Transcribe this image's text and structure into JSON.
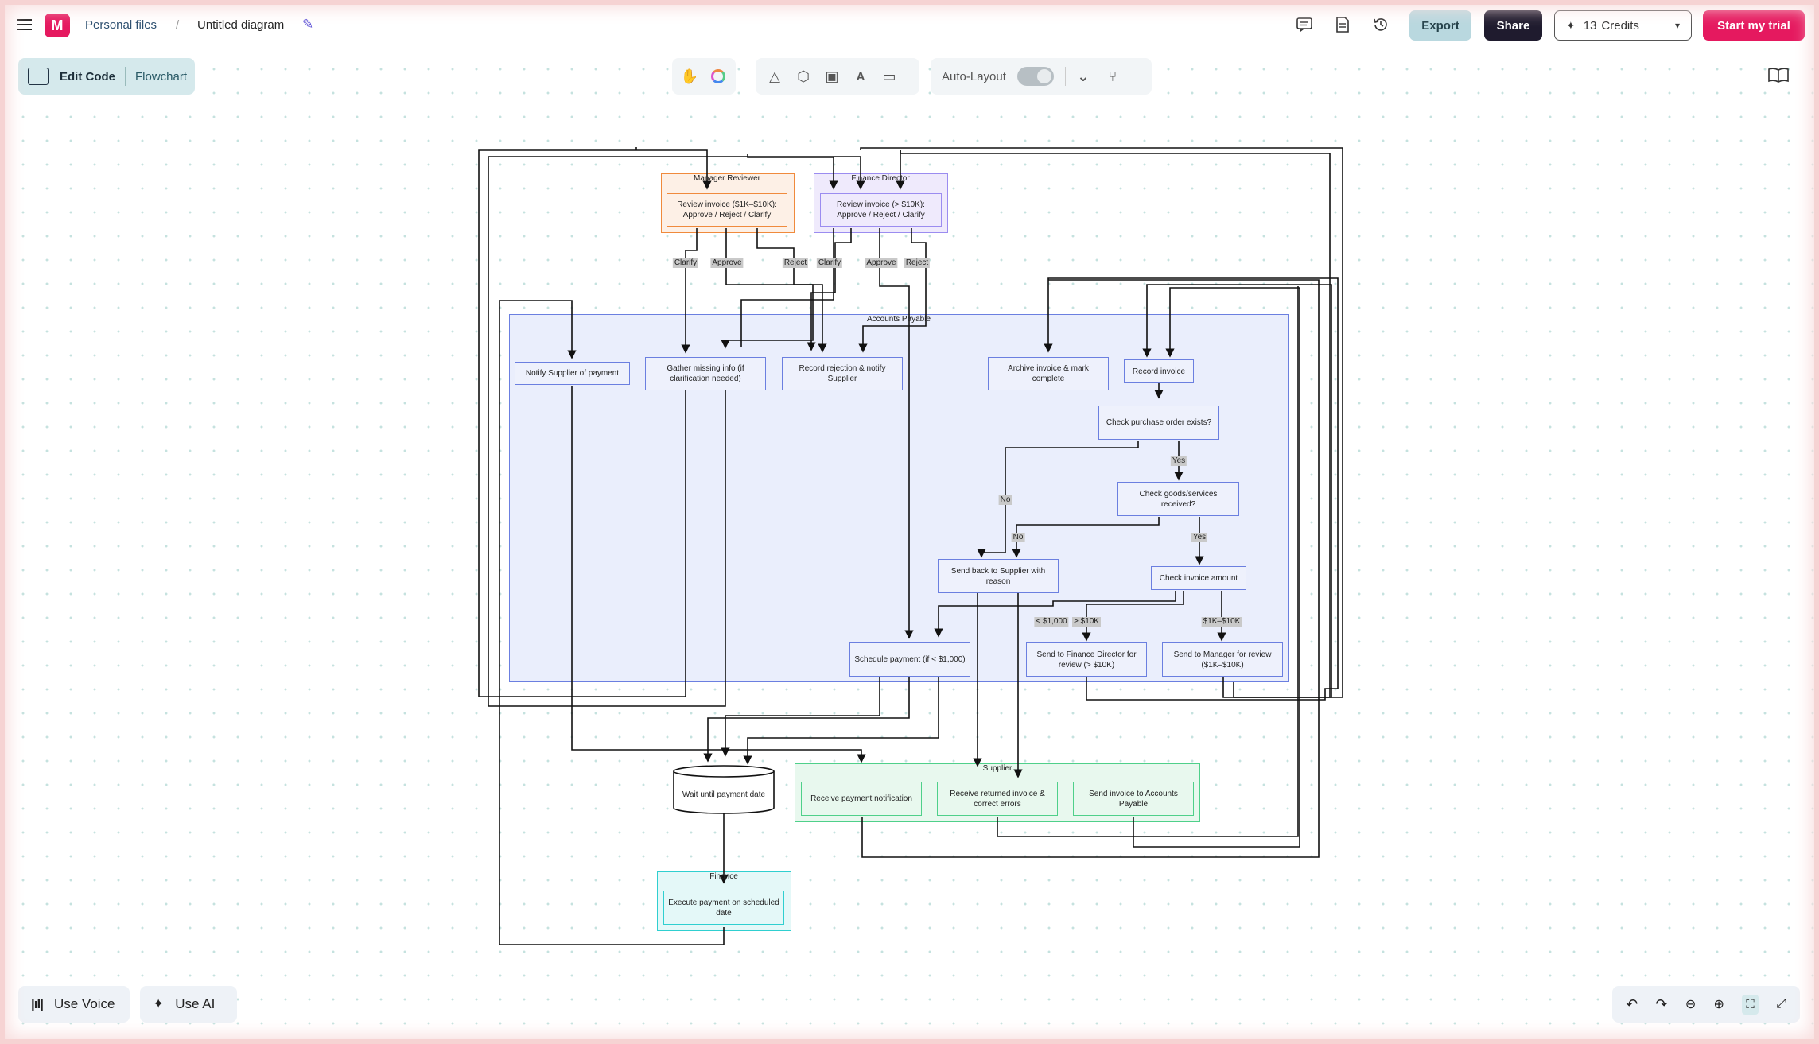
{
  "header": {
    "breadcrumb_root": "Personal files",
    "separator": "/",
    "title": "Untitled diagram",
    "export_label": "Export",
    "share_label": "Share",
    "credits_count": "13",
    "credits_label": "Credits",
    "trial_label": "Start my trial"
  },
  "mode": {
    "edit_code_label": "Edit Code",
    "diagram_type": "Flowchart"
  },
  "toolbar": {
    "auto_layout_label": "Auto-Layout",
    "auto_layout_on": false
  },
  "bottom": {
    "voice_label": "Use Voice",
    "ai_label": "Use AI"
  },
  "colors": {
    "brand": "#e5195f",
    "export_bg": "#b9d8df",
    "share_bg": "#1f1b2e",
    "ap_border": "#6b7fe0",
    "ap_fill": "#eaeefc",
    "manager_border": "#f08a3c",
    "finance_dir_border": "#9b8cf0",
    "supplier_border": "#4fd08a",
    "finance_border": "#2fcfd0"
  },
  "diagram": {
    "groups": {
      "manager": "Manager Reviewer",
      "finance_director": "Finance Director",
      "accounts_payable": "Accounts Payable",
      "supplier": "Supplier",
      "finance": "Finance"
    },
    "nodes": {
      "manager_review": "Review invoice ($1K–$10K): Approve / Reject / Clarify",
      "director_review": "Review invoice (> $10K): Approve / Reject / Clarify",
      "notify_supplier": "Notify Supplier of payment",
      "gather_info": "Gather missing info (if clarification needed)",
      "record_rejection": "Record rejection & notify Supplier",
      "archive": "Archive invoice & mark complete",
      "record_invoice": "Record invoice",
      "check_po": "Check purchase order exists?",
      "check_goods": "Check goods/services received?",
      "send_back": "Send back to Supplier with reason",
      "check_amount": "Check invoice amount",
      "schedule_payment": "Schedule payment (if < $1,000)",
      "send_director": "Send to Finance Director for review (> $10K)",
      "send_manager": "Send to Manager for review ($1K–$10K)",
      "wait_payment": "Wait until payment date",
      "receive_payment": "Receive payment notification",
      "receive_returned": "Receive returned invoice & correct errors",
      "send_invoice": "Send invoice to Accounts Payable",
      "execute_payment": "Execute payment on scheduled date"
    },
    "edge_labels": {
      "m_clarify": "Clarify",
      "m_approve": "Approve",
      "m_reject": "Reject",
      "d_clarify": "Clarify",
      "d_approve": "Approve",
      "d_reject": "Reject",
      "po_yes": "Yes",
      "po_no": "No",
      "goods_yes": "Yes",
      "goods_no": "No",
      "amt_low": "< $1,000",
      "amt_high": "> $10K",
      "amt_mid": "$1K–$10K"
    }
  }
}
